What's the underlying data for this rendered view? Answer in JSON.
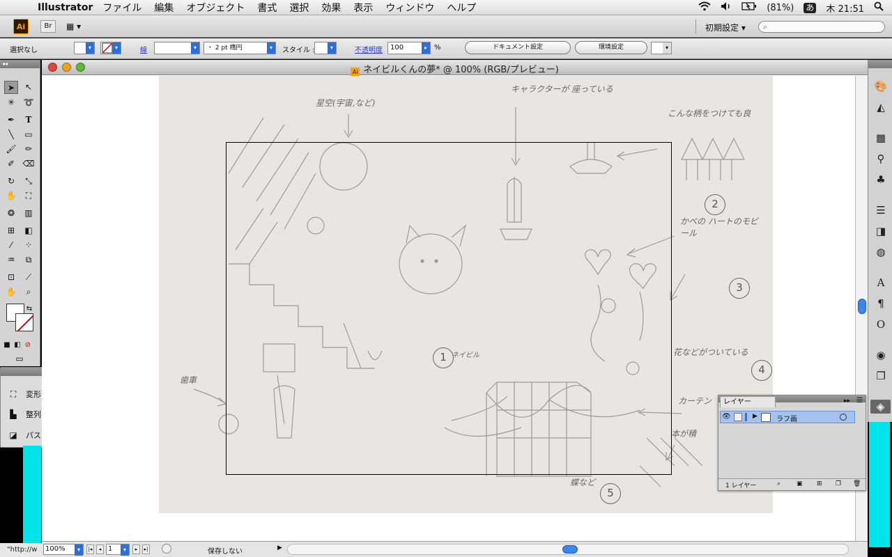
{
  "menubar": {
    "app_name": "Illustrator",
    "items": [
      "ファイル",
      "編集",
      "オブジェクト",
      "書式",
      "選択",
      "効果",
      "表示",
      "ウィンドウ",
      "ヘルプ"
    ],
    "battery": "(81%)",
    "input_method": "あ",
    "clock": "木 21:51"
  },
  "appbar": {
    "ai_logo": "Ai",
    "bridge_label": "Br",
    "workspace": "初期設定 ▾"
  },
  "control": {
    "selection": "選択なし",
    "stroke_label": "線",
    "brush_value": "・ 2 pt 楕円",
    "style_label": "スタイル :",
    "opacity_label": "不透明度",
    "opacity_value": "100",
    "percent": "%",
    "doc_setup": "ドキュメント設定",
    "preferences": "環境設定"
  },
  "mini_panel": {
    "items": [
      {
        "label": "変形",
        "icon": "transform-icon"
      },
      {
        "label": "整列",
        "icon": "align-icon"
      },
      {
        "label": "パスファインダ",
        "icon": "pathfinder-icon"
      }
    ]
  },
  "document": {
    "title": "ネイビルくんの夢* @ 100% (RGB/プレビュー)",
    "zoom": "100%",
    "page": "1",
    "save_status": "保存しない"
  },
  "status_left": "\"http://w",
  "layers": {
    "tab_label": "レイヤー",
    "layer_name": "ラフ画",
    "count_label": "1 レイヤー"
  },
  "sketch": {
    "notes": [
      {
        "id": "n1",
        "text": "星空(宇宙,など)"
      },
      {
        "id": "n2",
        "text": "キャラクターが 座っている"
      },
      {
        "id": "n3",
        "text": "こんな柄をつけても良"
      },
      {
        "id": "n4",
        "text": "かべの ハートのモビール"
      },
      {
        "id": "n5",
        "text": "花などがついている"
      },
      {
        "id": "n6",
        "text": "カーテン"
      },
      {
        "id": "n7",
        "text": "本が積"
      },
      {
        "id": "n8",
        "text": "歯車"
      },
      {
        "id": "n9",
        "text": "蝶など"
      },
      {
        "id": "n10",
        "text": "ネイビル"
      }
    ],
    "numbers": [
      "1",
      "2",
      "3",
      "4",
      "5"
    ]
  }
}
